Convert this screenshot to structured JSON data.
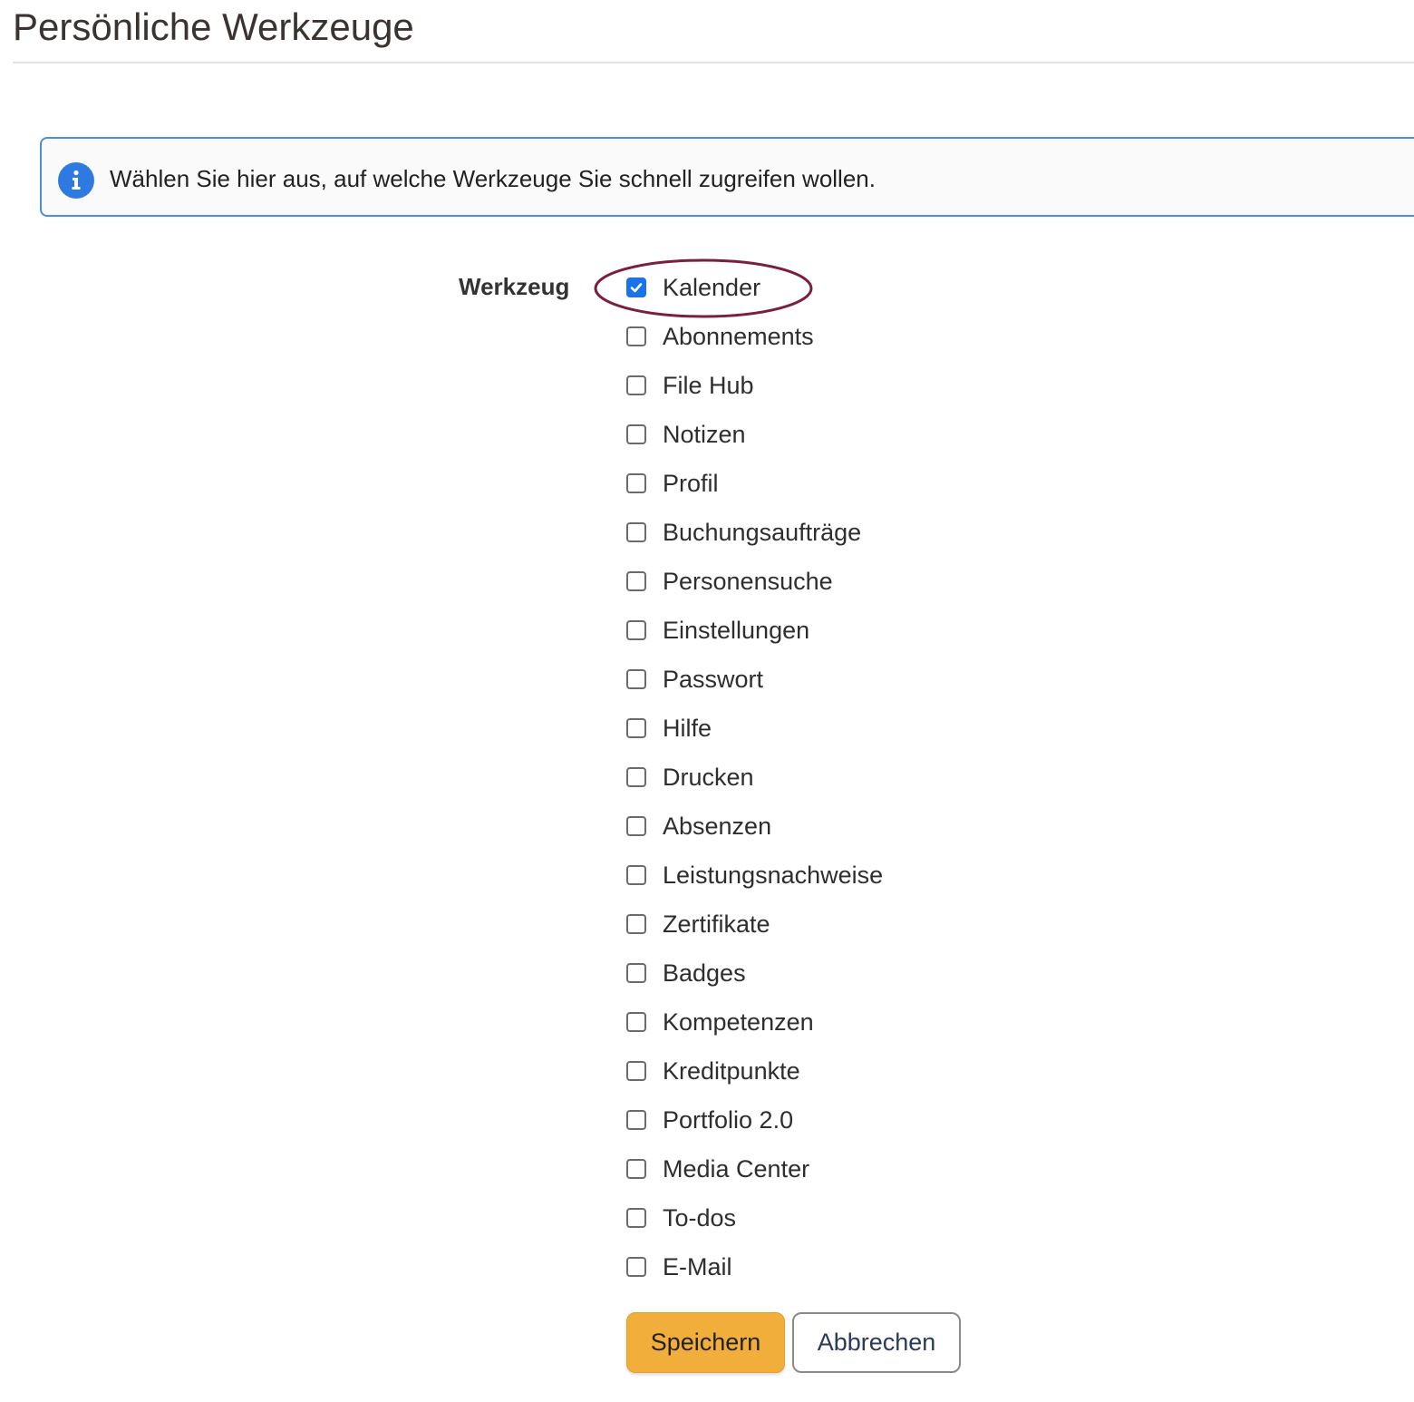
{
  "page": {
    "title": "Persönliche Werkzeuge"
  },
  "info": {
    "icon": "info-icon",
    "text": "Wählen Sie hier aus, auf welche Werkzeuge Sie schnell zugreifen wollen."
  },
  "form": {
    "label": "Werkzeug",
    "tools": [
      {
        "label": "Kalender",
        "checked": true
      },
      {
        "label": "Abonnements",
        "checked": false
      },
      {
        "label": "File Hub",
        "checked": false
      },
      {
        "label": "Notizen",
        "checked": false
      },
      {
        "label": "Profil",
        "checked": false
      },
      {
        "label": "Buchungsaufträge",
        "checked": false
      },
      {
        "label": "Personensuche",
        "checked": false
      },
      {
        "label": "Einstellungen",
        "checked": false
      },
      {
        "label": "Passwort",
        "checked": false
      },
      {
        "label": "Hilfe",
        "checked": false
      },
      {
        "label": "Drucken",
        "checked": false
      },
      {
        "label": "Absenzen",
        "checked": false
      },
      {
        "label": "Leistungsnachweise",
        "checked": false
      },
      {
        "label": "Zertifikate",
        "checked": false
      },
      {
        "label": "Badges",
        "checked": false
      },
      {
        "label": "Kompetenzen",
        "checked": false
      },
      {
        "label": "Kreditpunkte",
        "checked": false
      },
      {
        "label": "Portfolio 2.0",
        "checked": false
      },
      {
        "label": "Media Center",
        "checked": false
      },
      {
        "label": "To-dos",
        "checked": false
      },
      {
        "label": "E-Mail",
        "checked": false
      }
    ]
  },
  "buttons": {
    "save_label": "Speichern",
    "cancel_label": "Abbrechen"
  },
  "colors": {
    "accent_blue": "#1a73e8",
    "info_border": "#4a8fd8",
    "save_button": "#f1ae3b",
    "highlight_ellipse": "#7a1f3d"
  }
}
